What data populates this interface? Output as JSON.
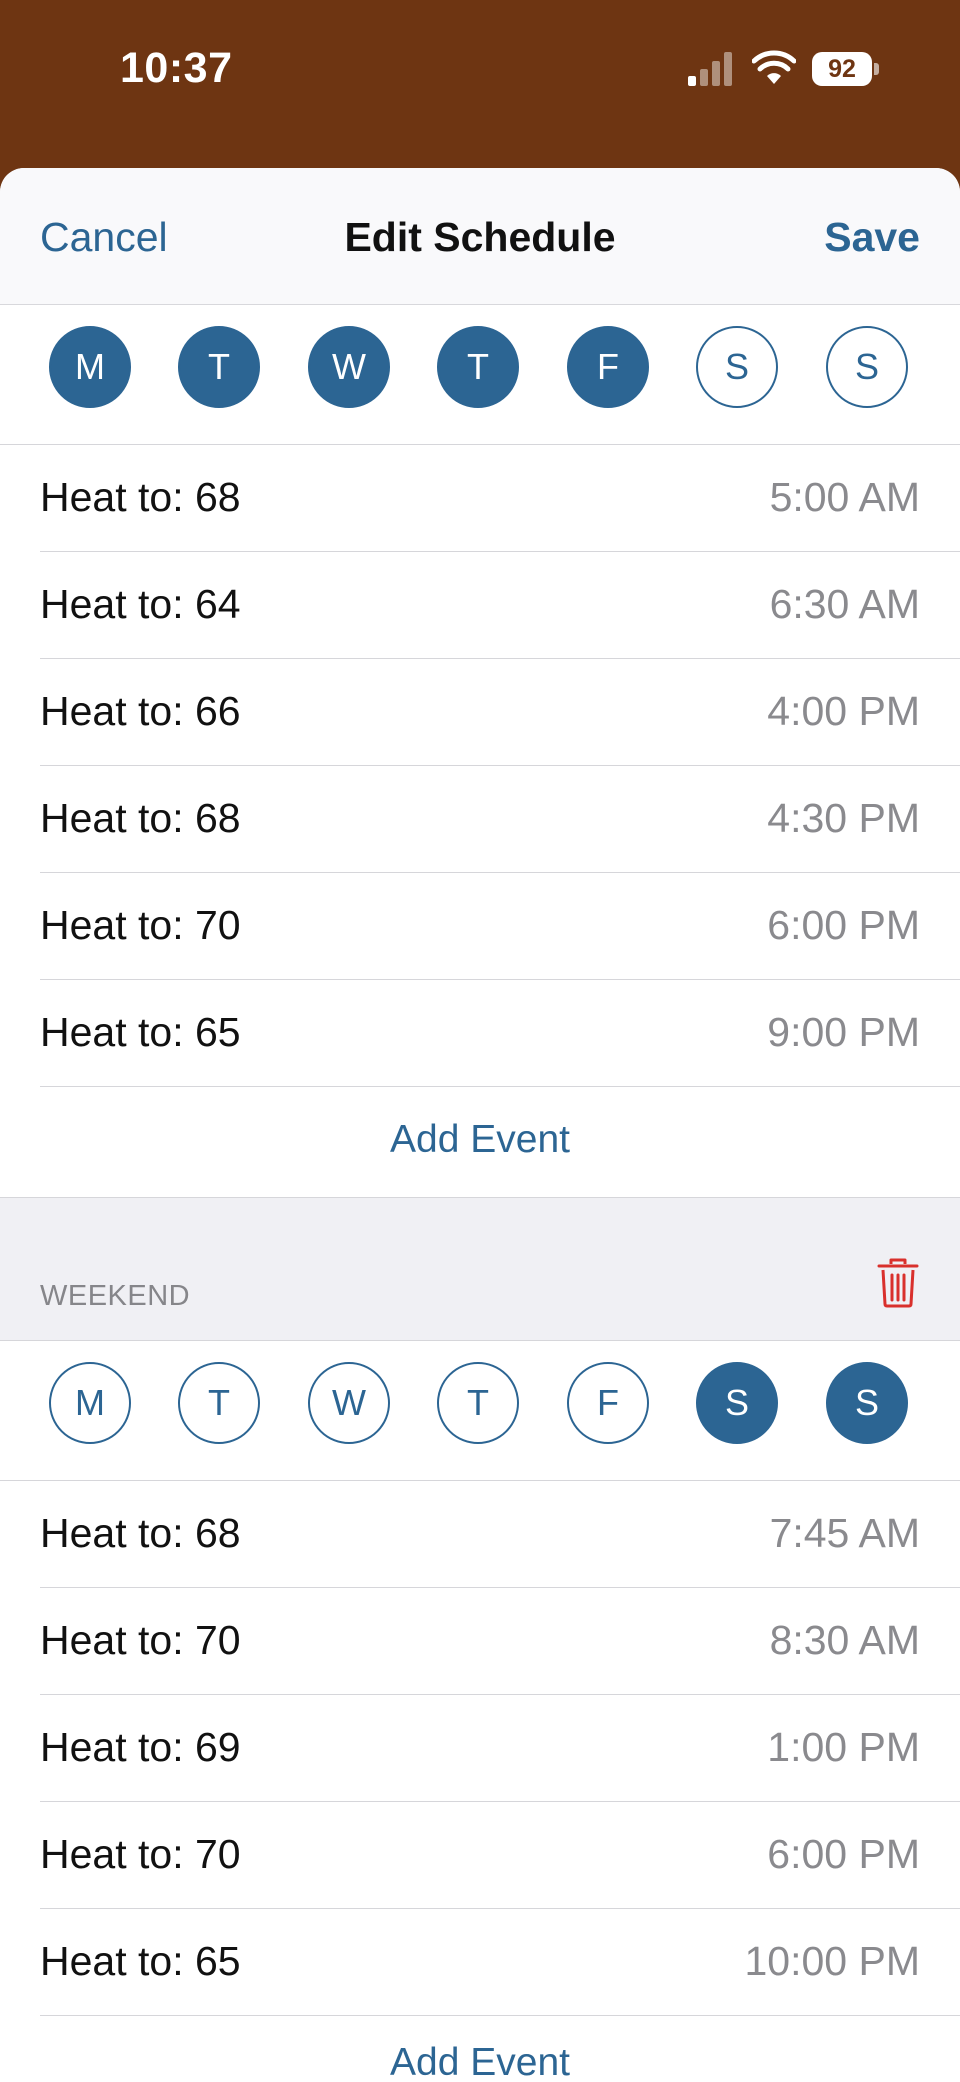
{
  "status_bar": {
    "time": "10:37",
    "battery": "92"
  },
  "nav": {
    "cancel": "Cancel",
    "title": "Edit Schedule",
    "save": "Save"
  },
  "weekday_schedule": {
    "days": [
      {
        "letter": "M",
        "selected": true
      },
      {
        "letter": "T",
        "selected": true
      },
      {
        "letter": "W",
        "selected": true
      },
      {
        "letter": "T",
        "selected": true
      },
      {
        "letter": "F",
        "selected": true
      },
      {
        "letter": "S",
        "selected": false
      },
      {
        "letter": "S",
        "selected": false
      }
    ],
    "events": [
      {
        "label": "Heat to: 68",
        "time": "5:00 AM"
      },
      {
        "label": "Heat to: 64",
        "time": "6:30 AM"
      },
      {
        "label": "Heat to: 66",
        "time": "4:00 PM"
      },
      {
        "label": "Heat to: 68",
        "time": "4:30 PM"
      },
      {
        "label": "Heat to: 70",
        "time": "6:00 PM"
      },
      {
        "label": "Heat to: 65",
        "time": "9:00 PM"
      }
    ],
    "add_event": "Add Event"
  },
  "weekend_schedule": {
    "header": "WEEKEND",
    "days": [
      {
        "letter": "M",
        "selected": false
      },
      {
        "letter": "T",
        "selected": false
      },
      {
        "letter": "W",
        "selected": false
      },
      {
        "letter": "T",
        "selected": false
      },
      {
        "letter": "F",
        "selected": false
      },
      {
        "letter": "S",
        "selected": true
      },
      {
        "letter": "S",
        "selected": true
      }
    ],
    "events": [
      {
        "label": "Heat to: 68",
        "time": "7:45 AM"
      },
      {
        "label": "Heat to: 70",
        "time": "8:30 AM"
      },
      {
        "label": "Heat to: 69",
        "time": "1:00 PM"
      },
      {
        "label": "Heat to: 70",
        "time": "6:00 PM"
      },
      {
        "label": "Heat to: 65",
        "time": "10:00 PM"
      }
    ],
    "add_event": "Add Event"
  },
  "colors": {
    "accent": "#2c6593",
    "delete": "#d9302c",
    "status_bg": "#6e3512"
  },
  "icons": {
    "signal": "cellular-signal-icon",
    "wifi": "wifi-icon",
    "battery": "battery-icon",
    "delete": "trash-icon"
  }
}
